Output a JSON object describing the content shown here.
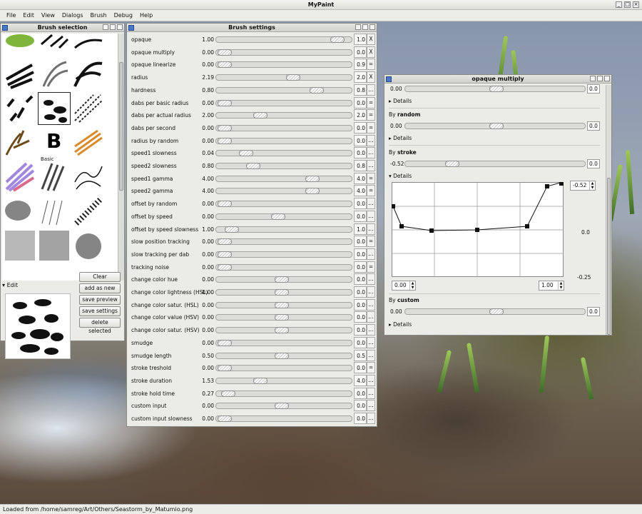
{
  "app": {
    "title": "MyPaint"
  },
  "menu": [
    "File",
    "Edit",
    "View",
    "Dialogs",
    "Brush",
    "Debug",
    "Help"
  ],
  "brush_selection": {
    "title": "Brush selection",
    "basic_label": "Basic",
    "edit_label": "Edit",
    "buttons": [
      "Clear",
      "add as new",
      "save preview",
      "save settings",
      "delete selected"
    ]
  },
  "brush_settings": {
    "title": "Brush settings",
    "rows": [
      {
        "label": "opaque",
        "value": "1.00",
        "fill": 0.95,
        "num": "1.0",
        "act": "X"
      },
      {
        "label": "opaque multiply",
        "value": "0.00",
        "fill": 0.0,
        "num": "0.0",
        "act": "X"
      },
      {
        "label": "opaque linearize",
        "value": "0.00",
        "fill": 0.0,
        "num": "0.9",
        "act": "="
      },
      {
        "label": "radius",
        "value": "2.19",
        "fill": 0.58,
        "num": "2.0",
        "act": "X"
      },
      {
        "label": "hardness",
        "value": "0.80",
        "fill": 0.78,
        "num": "0.8",
        "act": "..."
      },
      {
        "label": "dabs per basic radius",
        "value": "0.00",
        "fill": 0.0,
        "num": "0.0",
        "act": "="
      },
      {
        "label": "dabs per actual radius",
        "value": "2.00",
        "fill": 0.3,
        "num": "2.0",
        "act": "="
      },
      {
        "label": "dabs per second",
        "value": "0.00",
        "fill": 0.0,
        "num": "0.0",
        "act": "="
      },
      {
        "label": "radius by random",
        "value": "0.00",
        "fill": 0.0,
        "num": "0.0",
        "act": "..."
      },
      {
        "label": "speed1 slowness",
        "value": "0.04",
        "fill": 0.18,
        "num": "0.0",
        "act": "..."
      },
      {
        "label": "speed2 slowness",
        "value": "0.80",
        "fill": 0.24,
        "num": "0.8",
        "act": "..."
      },
      {
        "label": "speed1 gamma",
        "value": "4.00",
        "fill": 0.74,
        "num": "4.0",
        "act": "="
      },
      {
        "label": "speed2 gamma",
        "value": "4.00",
        "fill": 0.74,
        "num": "4.0",
        "act": "="
      },
      {
        "label": "offset by random",
        "value": "0.00",
        "fill": 0.0,
        "num": "0.0",
        "act": "..."
      },
      {
        "label": "offset by speed",
        "value": "0.00",
        "fill": 0.45,
        "num": "0.0",
        "act": "..."
      },
      {
        "label": "offset by speed slowness",
        "value": "1.00",
        "fill": 0.06,
        "num": "1.0",
        "act": "..."
      },
      {
        "label": "slow position tracking",
        "value": "0.00",
        "fill": 0.0,
        "num": "0.0",
        "act": "="
      },
      {
        "label": "slow tracking per dab",
        "value": "0.00",
        "fill": 0.0,
        "num": "0.0",
        "act": "..."
      },
      {
        "label": "tracking noise",
        "value": "0.00",
        "fill": 0.0,
        "num": "0.0",
        "act": "="
      },
      {
        "label": "change color hue",
        "value": "0.00",
        "fill": 0.48,
        "num": "0.0",
        "act": "..."
      },
      {
        "label": "change color lightness (HSL)",
        "value": "0.00",
        "fill": 0.48,
        "num": "0.0",
        "act": "..."
      },
      {
        "label": "change color satur. (HSL)",
        "value": "0.00",
        "fill": 0.48,
        "num": "0.0",
        "act": "..."
      },
      {
        "label": "change color value (HSV)",
        "value": "0.00",
        "fill": 0.48,
        "num": "0.0",
        "act": "..."
      },
      {
        "label": "change color satur. (HSV)",
        "value": "0.00",
        "fill": 0.48,
        "num": "0.0",
        "act": "..."
      },
      {
        "label": "smudge",
        "value": "0.00",
        "fill": 0.0,
        "num": "0.0",
        "act": "..."
      },
      {
        "label": "smudge length",
        "value": "0.50",
        "fill": 0.48,
        "num": "0.5",
        "act": "..."
      },
      {
        "label": "stroke treshold",
        "value": "0.00",
        "fill": 0.0,
        "num": "0.0",
        "act": "="
      },
      {
        "label": "stroke duration",
        "value": "1.53",
        "fill": 0.3,
        "num": "4.0",
        "act": "..."
      },
      {
        "label": "stroke hold time",
        "value": "0.27",
        "fill": 0.03,
        "num": "0.0",
        "act": "..."
      },
      {
        "label": "custom input",
        "value": "0.00",
        "fill": 0.48,
        "num": "0.0",
        "act": "..."
      },
      {
        "label": "custom input slowness",
        "value": "0.00",
        "fill": 0.0,
        "num": "0.0",
        "act": "..."
      }
    ]
  },
  "opaque_multiply": {
    "title": "opaque multiply",
    "top_value": "0.00",
    "top_box": "0.0",
    "details": "Details",
    "random": {
      "label_pre": "By ",
      "label_b": "random",
      "value": "0.00",
      "box": "0.0"
    },
    "stroke": {
      "label_pre": "By ",
      "label_b": "stroke",
      "value": "-0.52",
      "box": "0.0",
      "ymax": "-0.52",
      "ymid": "0.0",
      "ymin": "-0.25",
      "xmin": "0.00",
      "xmax": "1.00"
    },
    "custom": {
      "label_pre": "By ",
      "label_b": "custom",
      "value": "0.00",
      "box": "0.0"
    }
  },
  "status": "Loaded from /home/samreg/Art/Others/Seastorm_by_Matumio.png"
}
